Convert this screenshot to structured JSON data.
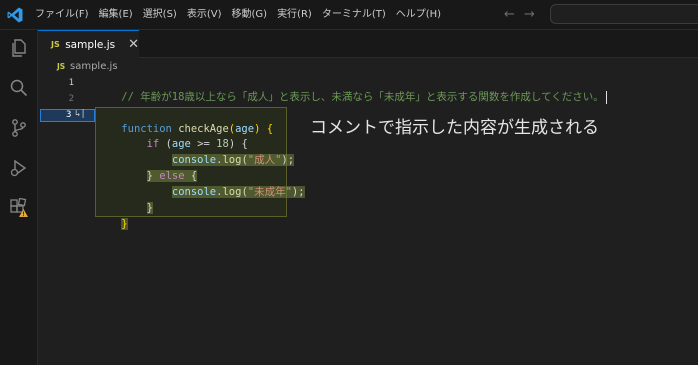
{
  "menu": {
    "items": [
      "ファイル(F)",
      "編集(E)",
      "選択(S)",
      "表示(V)",
      "移動(G)",
      "実行(R)",
      "ターミナル(T)",
      "ヘルプ(H)"
    ]
  },
  "nav": {
    "back": "←",
    "forward": "→"
  },
  "tab": {
    "badge": "JS",
    "label": "sample.js",
    "close": "✕"
  },
  "breadcrumb": {
    "badge": "JS",
    "label": "sample.js"
  },
  "gutter": {
    "line1": "1",
    "line2": "2",
    "line3": "3",
    "line3_icon": "↳|"
  },
  "code": {
    "comment": "// 年齢が18歳以上なら「成人」と表示し、未満なら「未成年」と表示する関数を作成してください。",
    "l3_kw": "function",
    "l3_fn": "checkAge",
    "l3_paren_open": "(",
    "l3_param": "age",
    "l3_rest": ") {",
    "l4_kw": "if",
    "l4_a": " (",
    "l4_var": "age",
    "l4_op": " >= ",
    "l4_num": "18",
    "l4_end": ") {",
    "l5_obj": "console",
    "l5_dot": ".",
    "l5_fn": "log",
    "l5_open": "(",
    "l5_str": "\"成人\"",
    "l5_close": ");",
    "l6_close": "} ",
    "l6_kw": "else",
    "l6_open": " {",
    "l7_obj": "console",
    "l7_dot": ".",
    "l7_fn": "log",
    "l7_open": "(",
    "l7_str": "\"未成年\"",
    "l7_close": ");",
    "l8": "}",
    "l9": "}"
  },
  "annotation": "コメントで指示した内容が生成される",
  "colors": {
    "accent": "#0078d4",
    "comment": "#6a9955",
    "keyword": "#569cd6",
    "function": "#dcdcaa",
    "string": "#ce9178"
  }
}
